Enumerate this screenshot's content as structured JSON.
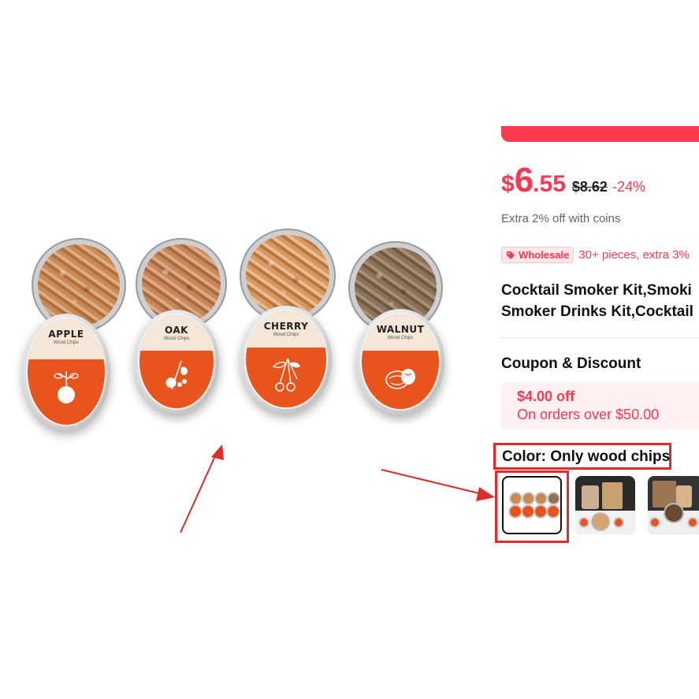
{
  "product_image": {
    "tins": [
      {
        "name": "APPLE",
        "sub": "Wood Chips",
        "icon": "apple-branch-icon"
      },
      {
        "name": "OAK",
        "sub": "Wood Chips",
        "icon": "oak-leaf-icon"
      },
      {
        "name": "CHERRY",
        "sub": "Wood Chips",
        "icon": "cherry-icon"
      },
      {
        "name": "WALNUT",
        "sub": "Wood Chips",
        "icon": "walnut-icon"
      }
    ]
  },
  "price": {
    "currency": "$",
    "integer": "6",
    "decimal": ".55",
    "original": "$8.62",
    "discount": "-24%"
  },
  "coins_text": "Extra 2% off with coins",
  "wholesale": {
    "badge": "Wholesale",
    "text": "30+ pieces, extra 3%"
  },
  "title_lines": [
    "Cocktail Smoker Kit,Smoki",
    "Smoker Drinks Kit,Cocktail"
  ],
  "coupon": {
    "heading": "Coupon & Discount",
    "amount": "$4.00 off",
    "condition": "On orders over $50.00"
  },
  "color": {
    "label": "Color: Only wood chips",
    "options": [
      "Only wood chips",
      "Kit option 2",
      "Kit option 3"
    ],
    "selected_index": 0
  },
  "colors": {
    "accent": "#fd384f",
    "annotation": "#e02b2b",
    "label_orange": "#e8541c"
  }
}
